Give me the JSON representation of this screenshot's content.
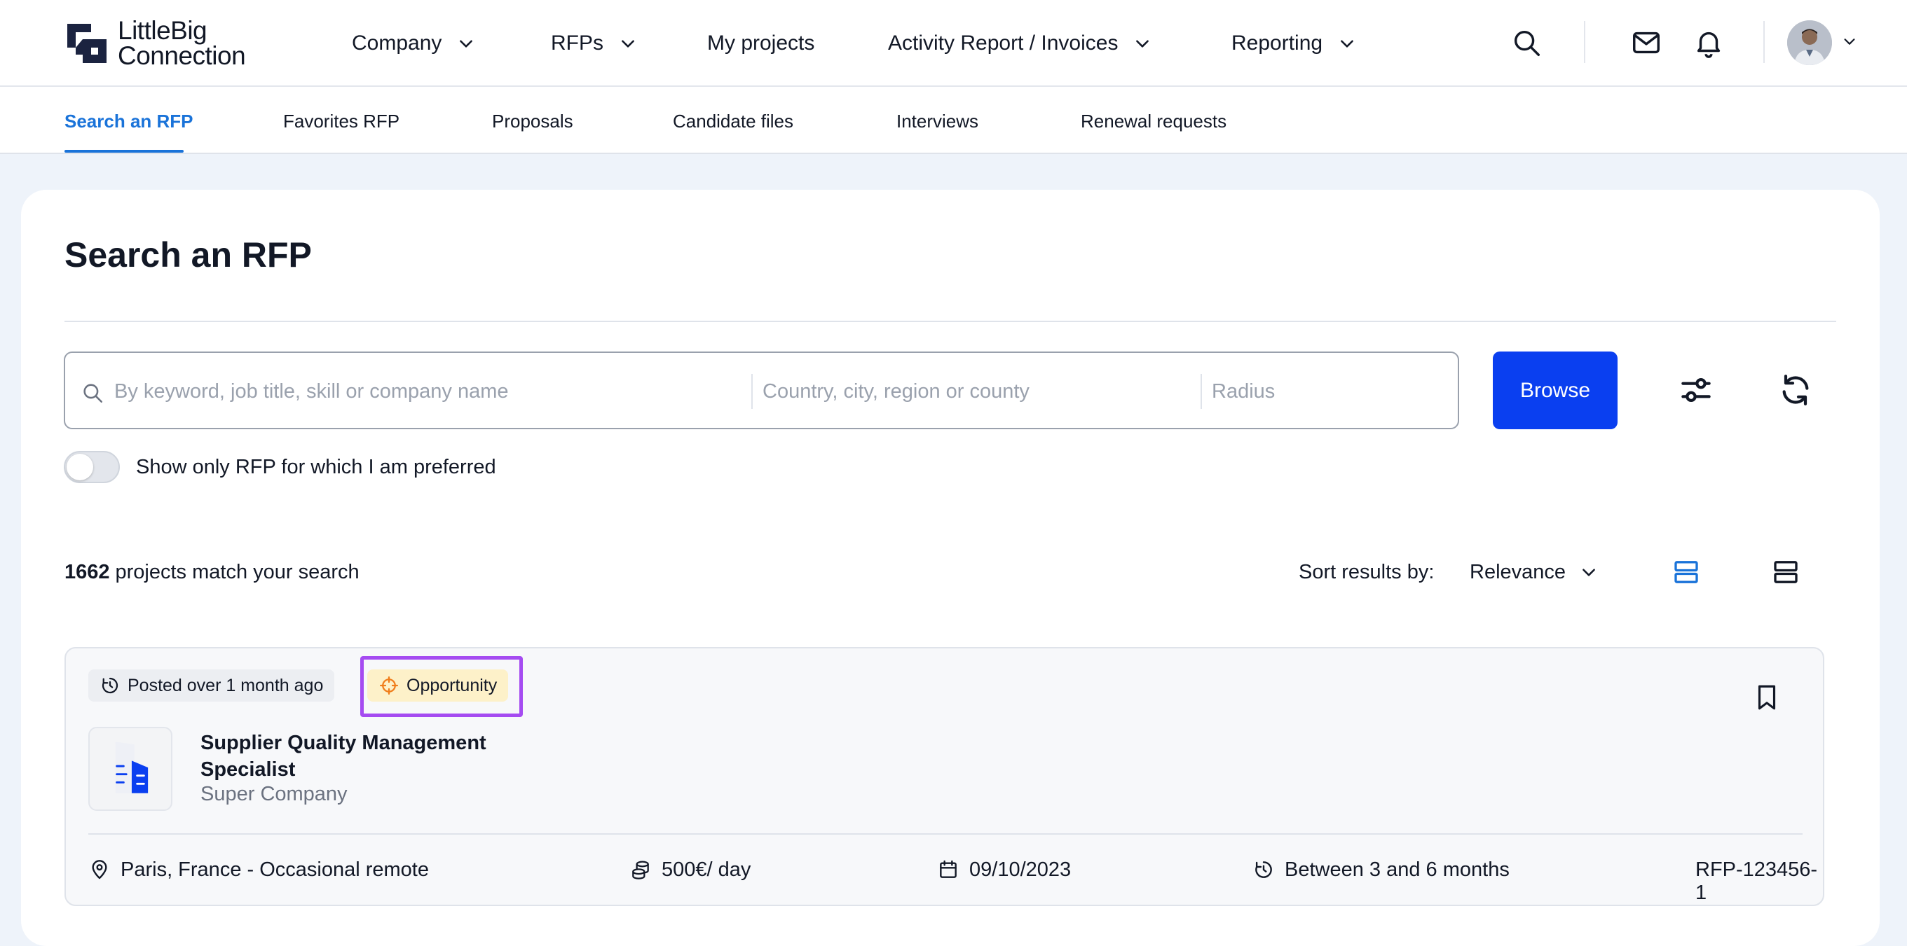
{
  "header": {
    "logo_text_line1": "LittleBig",
    "logo_text_line2": "Connection",
    "nav": [
      {
        "label": "Company",
        "has_dropdown": true
      },
      {
        "label": "RFPs",
        "has_dropdown": true
      },
      {
        "label": "My projects",
        "has_dropdown": false
      },
      {
        "label": "Activity Report / Invoices",
        "has_dropdown": true
      },
      {
        "label": "Reporting",
        "has_dropdown": true
      }
    ],
    "icons": [
      "search-icon",
      "mail-icon",
      "bell-icon",
      "avatar",
      "chevron-down-icon"
    ]
  },
  "subtabs": [
    {
      "label": "Search an RFP",
      "active": true
    },
    {
      "label": "Favorites RFP",
      "active": false
    },
    {
      "label": "Proposals",
      "active": false
    },
    {
      "label": "Candidate files",
      "active": false
    },
    {
      "label": "Interviews",
      "active": false
    },
    {
      "label": "Renewal requests",
      "active": false
    }
  ],
  "main": {
    "title": "Search an RFP",
    "search": {
      "keyword_placeholder": "By keyword, job title, skill or company name",
      "location_placeholder": "Country, city, region or county",
      "radius_placeholder": "Radius",
      "browse_label": "Browse"
    },
    "preferred_toggle": {
      "label": "Show only RFP for which I am preferred",
      "checked": false
    },
    "results": {
      "count": "1662",
      "count_suffix": "projects match your search",
      "sort_label": "Sort results by:",
      "sort_value": "Relevance"
    },
    "result_item": {
      "posted": "Posted over 1 month ago",
      "tag": "Opportunity",
      "title": "Supplier Quality Management Specialist",
      "company": "Super Company",
      "location": "Paris, France - Occasional remote",
      "rate": "500€/ day",
      "date": "09/10/2023",
      "duration": "Between 3 and 6 months",
      "reference": "RFP-123456-1"
    }
  },
  "colors": {
    "accent": "#1a73d9",
    "primary_button": "#0a3ff0",
    "highlight_outline": "#a54bf1",
    "opportunity_tag_bg": "#fdf1c9",
    "opportunity_icon": "#f07d1a",
    "page_bg": "#eef3fa"
  }
}
